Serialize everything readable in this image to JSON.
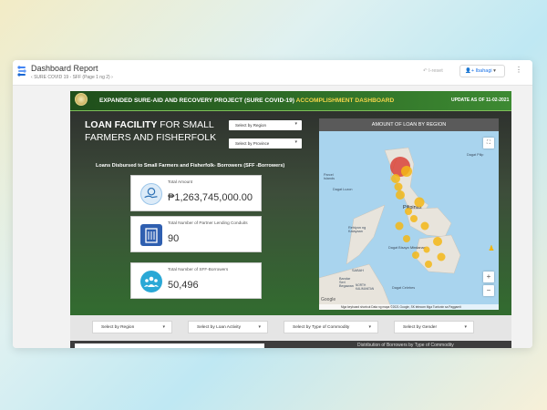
{
  "app": {
    "title": "Dashboard Report",
    "breadcrumb": "SURE COVID 19 - SFF (Page 1 ng 2)",
    "reset": "I-reset",
    "share": "Ibahagi",
    "more": "⋮"
  },
  "dashboard": {
    "header_title": "EXPANDED SURE-AID AND RECOVERY PROJECT (SURE COVID-19) ",
    "header_title_highlight": "ACCOMPLISHMENT DASHBOARD",
    "update": "UPDATE AS OF 11-02-2021",
    "loan_facility_line1_bold": "LOAN FACILITY",
    "loan_facility_line1_rest": " FOR SMALL",
    "loan_facility_line2": "FARMERS AND FISHERFOLK",
    "select_region": "Select by Region",
    "select_province": "Select by Province",
    "loans_heading": "Loans Disbursed to Small Farmers and Fisherfolk- Borrowers (SFF -Borrowers)",
    "cards": [
      {
        "label": "Total Amount",
        "value": "₱1,263,745,000.00"
      },
      {
        "label": "Total Number of Partner Lending Conduits",
        "value": "90"
      },
      {
        "label": "Total Number of SFF-Borrowers",
        "value": "50,496"
      }
    ],
    "map": {
      "title": "AMOUNT OF LOAN BY REGION",
      "labels": {
        "mar": "Dagat Pilip",
        "parcel": "Parcel\nIslands",
        "luzon": "Dagat Luzon",
        "pilipinas": "Pilipinas",
        "kalayaan": "Rehiyon ng\nKalayaan",
        "visayas": "Dagat Bisaya",
        "mindanao": "Mindanao",
        "sabah": "SABAH",
        "bandar": "Bandar\nSeri\nBegawan",
        "borneo": "NORTH\nKALIMANTAN",
        "celebes": "Dagat Celebes",
        "google": "Google"
      },
      "attribution": "Mga keyboard shortcut   Data ng mapa ©2021 Google, SK telecom   Mga Tuntunin sa Paggamit",
      "zoom_in": "+",
      "zoom_out": "−"
    }
  },
  "filters": [
    {
      "label": "Select by Region"
    },
    {
      "label": "Select by Loan Activity"
    },
    {
      "label": "Select by Type of Commodity"
    },
    {
      "label": "Select by Gender"
    }
  ],
  "bottom_text": "Distribution of Borrowers by Type of Commodity",
  "colors": {
    "accent": "#f2d54a",
    "bubble": "#f3b716",
    "bubble_big": "#d9433a",
    "green_dark": "#1f4e1b"
  }
}
